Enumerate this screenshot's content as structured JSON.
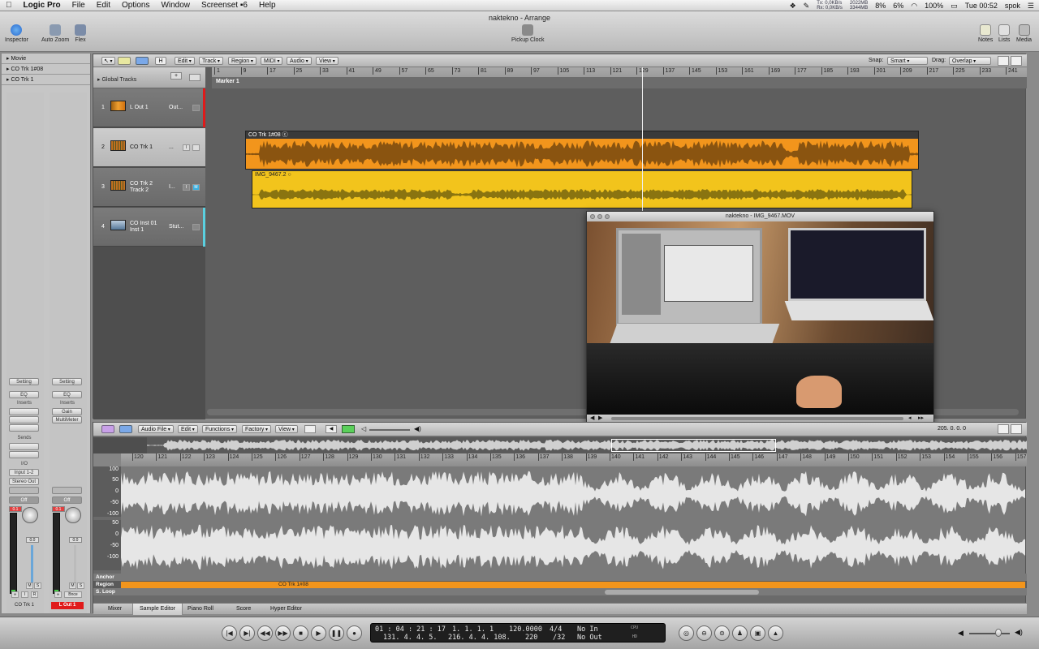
{
  "menubar": {
    "app": "Logic Pro",
    "items": [
      "File",
      "Edit",
      "Options",
      "Window",
      "Screenset ▪6",
      "Help"
    ],
    "net_tx": "Tx: 0,0KB/s",
    "net_rx": "Rx: 0,0KB/s",
    "mem1": "2022MB",
    "mem2": "3344MB",
    "cpu1": "8%",
    "cpu2": "6%",
    "battery": "100%",
    "clock": "Tue 00:52",
    "user": "spok"
  },
  "window": {
    "title": "naktekno - Arrange",
    "toolbar": {
      "inspector": "Inspector",
      "auto_zoom": "Auto Zoom",
      "flex": "Flex",
      "pickup_clock": "Pickup Clock",
      "notes": "Notes",
      "lists": "Lists",
      "media": "Media"
    }
  },
  "inspector": {
    "rows": [
      "Movie",
      "CO Trk 1#08",
      "CO Trk 1"
    ],
    "strip1": {
      "setting": "Setting",
      "eq": "EQ",
      "inserts": "Inserts",
      "sends": "Sends",
      "io": "I/O",
      "input": "Input 1-2",
      "output": "Stereo Out",
      "auto": "Off",
      "level": "0.0",
      "peak": "0.1",
      "m": "M",
      "s": "S",
      "i": "I",
      "r": "R",
      "name": "CO Trk 1"
    },
    "strip2": {
      "setting": "Setting",
      "eq": "EQ",
      "inserts": "Inserts",
      "gain": "Gain",
      "multimeter": "MultiMeter",
      "auto": "Off",
      "level": "0.0",
      "peak": "0.1",
      "m": "M",
      "s": "S",
      "bnce": "Bnce",
      "name": "L Out 1"
    }
  },
  "arrange": {
    "menus": [
      "Edit",
      "Track",
      "Region",
      "MIDI",
      "Audio",
      "View"
    ],
    "h_btn": "H",
    "snap_label": "Snap:",
    "snap_value": "Smart",
    "drag_label": "Drag:",
    "drag_value": "Overlap",
    "global_tracks": "Global Tracks",
    "marker": "Marker 1",
    "ruler": [
      "1",
      "9",
      "17",
      "25",
      "33",
      "41",
      "49",
      "57",
      "65",
      "73",
      "81",
      "89",
      "97",
      "105",
      "113",
      "121",
      "129",
      "137",
      "145",
      "153",
      "161",
      "169",
      "177",
      "185",
      "193",
      "201",
      "209",
      "217",
      "225",
      "233",
      "241"
    ],
    "tracks": [
      {
        "num": "1",
        "name": "L Out 1",
        "inst": "Out..."
      },
      {
        "num": "2",
        "name": "CO Trk 1",
        "inst": "..."
      },
      {
        "num": "3",
        "name": "CO Trk 2\nTrack 2",
        "inst": "I..."
      },
      {
        "num": "4",
        "name": "CO Inst 01\nInst 1",
        "inst": "Stut..."
      }
    ],
    "regions": [
      {
        "name": "CO Trk 1#08 ⓒ",
        "color": "#f2951c"
      },
      {
        "name": "IMG_9467.2 ○",
        "color": "#f2c41c"
      }
    ]
  },
  "video": {
    "title": "naktekno - IMG_9467.MOV"
  },
  "sample_editor": {
    "menus": [
      "Audio File",
      "Edit",
      "Functions",
      "Factory",
      "View"
    ],
    "position": "205.  0.  0.   0",
    "ruler": [
      "120",
      "121",
      "122",
      "123",
      "124",
      "125",
      "126",
      "127",
      "128",
      "129",
      "130",
      "131",
      "132",
      "133",
      "134",
      "135",
      "136",
      "137",
      "138",
      "139",
      "140",
      "141",
      "142",
      "143",
      "144",
      "145",
      "146",
      "147",
      "148",
      "149",
      "150",
      "151",
      "152",
      "153",
      "154",
      "155",
      "156",
      "157"
    ],
    "amp_labels": [
      "100",
      "50",
      "0",
      "-50",
      "-100",
      "50",
      "0",
      "-50",
      "-100"
    ],
    "lanes": {
      "anchor": "Anchor",
      "region": "Region",
      "sloop": "S. Loop",
      "region_name": "CO Trk 1#08"
    },
    "tabs": [
      "Mixer",
      "Sample Editor",
      "Piano Roll",
      "Score",
      "Hyper Editor"
    ]
  },
  "transport": {
    "smpte": "01 : 04 : 21 : 17",
    "smpte2": "131.  4.  4.  5.",
    "bars": "1.   1.   1.   1",
    "bars2": "216.  4.  4. 108.",
    "tempo": "120.0000",
    "tempo2": "220",
    "sig": "4/4",
    "div": "/32",
    "in": "No In",
    "out": "No Out",
    "cpu": "CPU",
    "hd": "HD"
  }
}
